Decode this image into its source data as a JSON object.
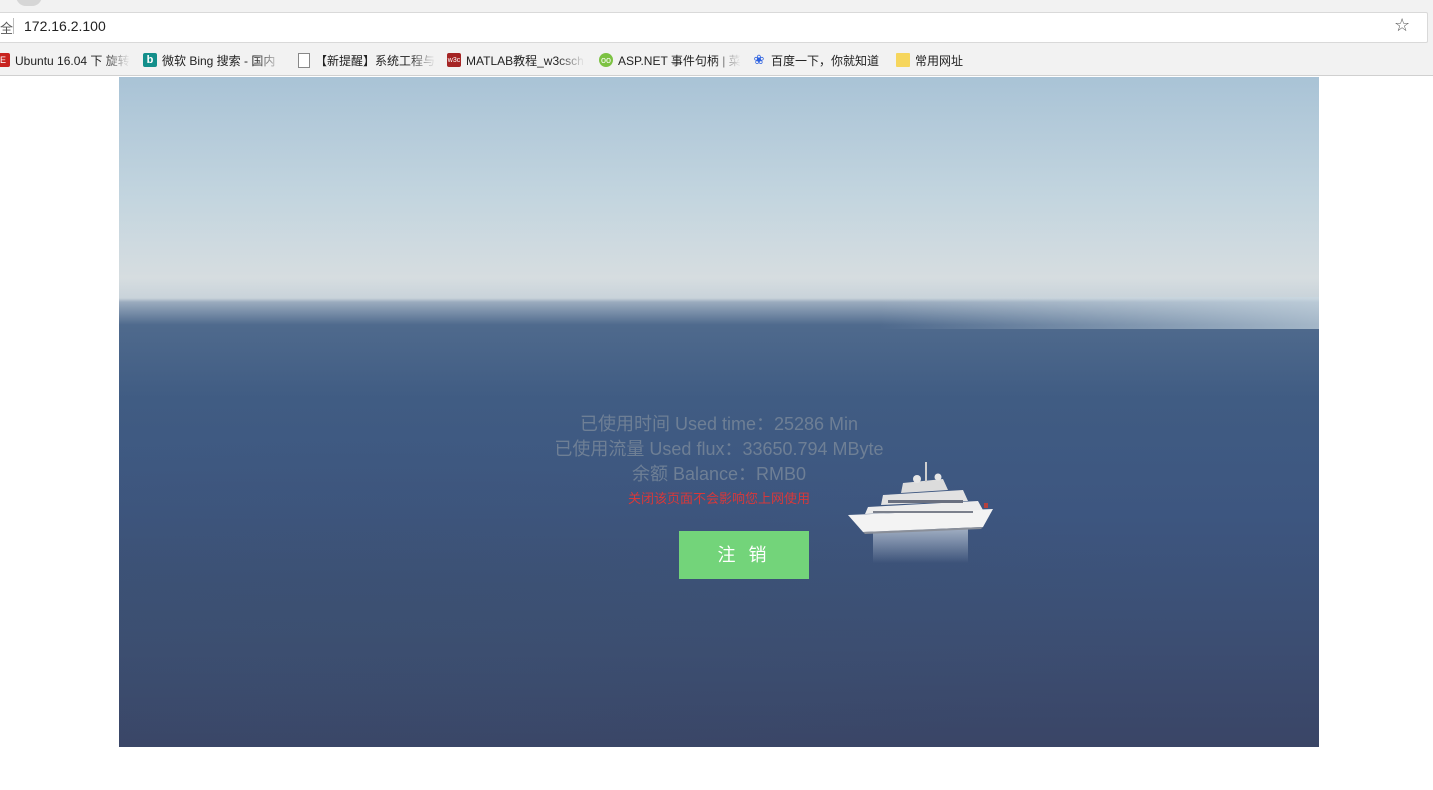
{
  "browser": {
    "secure_label": "全",
    "url": "172.16.2.100",
    "bookmarks": [
      {
        "label": "Ubuntu 16.04 下 旋转",
        "icon": "red-square-icon"
      },
      {
        "label": "微软 Bing 搜索 - 国内",
        "icon": "bing-icon"
      },
      {
        "label": "【新提醒】系统工程与",
        "icon": "page-icon"
      },
      {
        "label": "MATLAB教程_w3csch",
        "icon": "w3c-icon"
      },
      {
        "label": "ASP.NET 事件句柄 | 菜",
        "icon": "runoob-icon"
      },
      {
        "label": "百度一下，你就知道",
        "icon": "baidu-icon"
      },
      {
        "label": "常用网址",
        "icon": "folder-icon"
      }
    ]
  },
  "account": {
    "used_time": "已使用时间 Used time：25286 Min",
    "used_flux": "已使用流量 Used flux：33650.794 MByte",
    "balance": "余额 Balance：RMB0",
    "notice": "关闭该页面不会影响您上网使用"
  },
  "actions": {
    "logout_label": "注 销"
  },
  "colors": {
    "button_bg": "#73d47a",
    "notice_text": "#d8383a",
    "info_text": "#6e7f95"
  }
}
